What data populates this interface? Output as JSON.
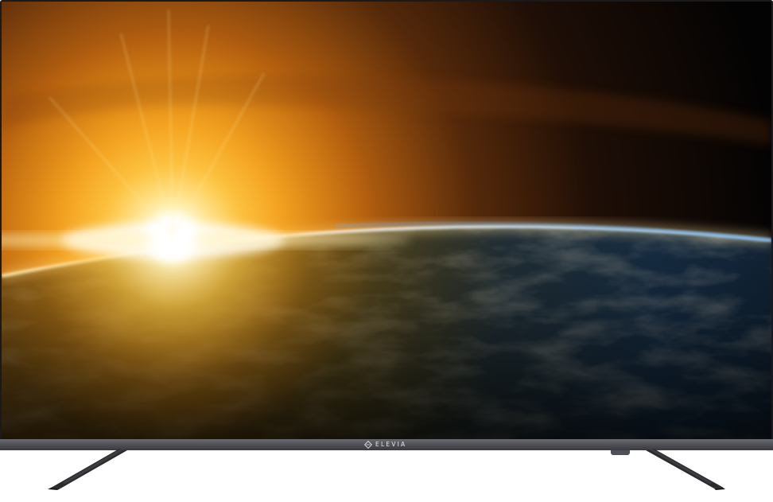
{
  "brand": {
    "logo_text": "ELEVIA"
  },
  "colors": {
    "bezel": "#1a1a1c",
    "chin": "#55565b",
    "stand": "#2b2b2e",
    "sun_core": "#fffbe6",
    "atmosphere_glow": "#ffd978",
    "ocean": "#2c5f8a"
  },
  "icons": {
    "logo_mark": "diamond-logo-icon"
  }
}
